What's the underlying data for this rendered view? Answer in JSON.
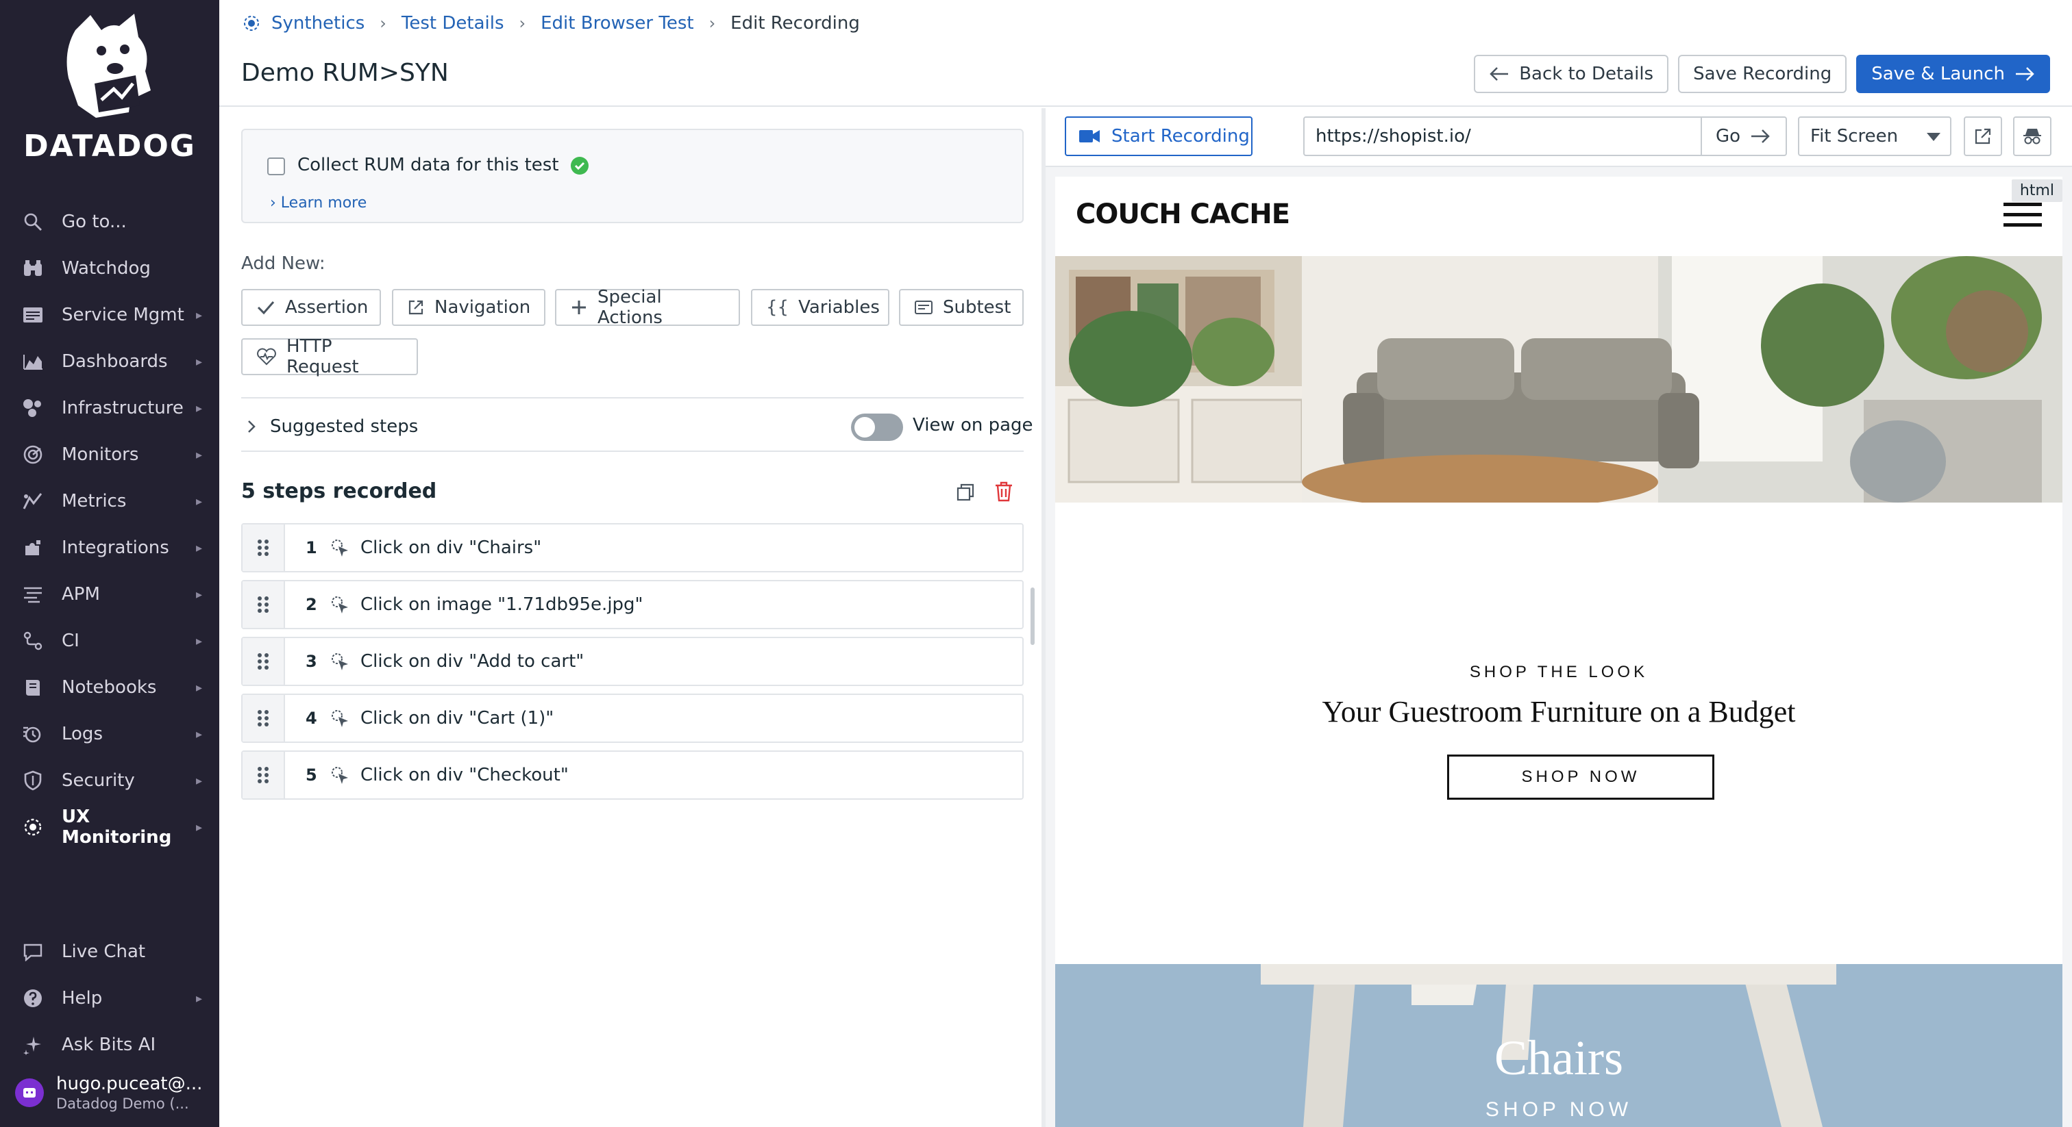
{
  "brand": {
    "name": "DATADOG",
    "colors": {
      "sidebar": "#232131",
      "link": "#2363b5",
      "primary": "#2165c8",
      "danger": "#e0373a",
      "success": "#3fb950"
    }
  },
  "sidebar": {
    "items": [
      {
        "label": "Go to...",
        "icon": "search-icon",
        "has_submenu": false
      },
      {
        "label": "Watchdog",
        "icon": "binoculars-icon",
        "has_submenu": false
      },
      {
        "label": "Service Mgmt",
        "icon": "service-icon",
        "has_submenu": true
      },
      {
        "label": "Dashboards",
        "icon": "chart-area-icon",
        "has_submenu": true
      },
      {
        "label": "Infrastructure",
        "icon": "hexagons-icon",
        "has_submenu": true
      },
      {
        "label": "Monitors",
        "icon": "monitor-icon",
        "has_submenu": true
      },
      {
        "label": "Metrics",
        "icon": "metrics-icon",
        "has_submenu": true
      },
      {
        "label": "Integrations",
        "icon": "puzzle-icon",
        "has_submenu": true
      },
      {
        "label": "APM",
        "icon": "apm-icon",
        "has_submenu": true
      },
      {
        "label": "CI",
        "icon": "ci-icon",
        "has_submenu": true
      },
      {
        "label": "Notebooks",
        "icon": "notebook-icon",
        "has_submenu": true
      },
      {
        "label": "Logs",
        "icon": "logs-icon",
        "has_submenu": true
      },
      {
        "label": "Security",
        "icon": "shield-icon",
        "has_submenu": true
      },
      {
        "label": "UX Monitoring",
        "icon": "ux-icon",
        "has_submenu": true,
        "active": true
      }
    ],
    "bottom_items": [
      {
        "label": "Live Chat",
        "icon": "chat-icon",
        "has_submenu": false
      },
      {
        "label": "Help",
        "icon": "help-icon",
        "has_submenu": true
      },
      {
        "label": "Ask Bits AI",
        "icon": "sparkle-icon",
        "has_submenu": false
      }
    ],
    "user": {
      "name": "hugo.puceat@...",
      "org": "Datadog Demo (..."
    }
  },
  "header": {
    "breadcrumb": [
      "Synthetics",
      "Test Details",
      "Edit Browser Test",
      "Edit Recording"
    ],
    "title": "Demo RUM>SYN",
    "back_label": "Back to Details",
    "save_label": "Save Recording",
    "save_launch_label": "Save & Launch"
  },
  "editor": {
    "rum_label": "Collect RUM data for this test",
    "rum_checked": false,
    "learn_more": "Learn more",
    "add_new_label": "Add New:",
    "add_buttons": {
      "assertion": "Assertion",
      "navigation": "Navigation",
      "special": "Special Actions",
      "variables": "Variables",
      "subtest": "Subtest",
      "http": "HTTP Request"
    },
    "suggested_label": "Suggested steps",
    "view_on_page_label": "View on page",
    "view_on_page_on": false,
    "steps_title": "5 steps recorded",
    "steps": [
      {
        "num": "1",
        "label": "Click on div \"Chairs\""
      },
      {
        "num": "2",
        "label": "Click on image \"1.71db95e.jpg\""
      },
      {
        "num": "3",
        "label": "Click on div \"Add to cart\""
      },
      {
        "num": "4",
        "label": "Click on div \"Cart (1)\""
      },
      {
        "num": "5",
        "label": "Click on div \"Checkout\""
      }
    ]
  },
  "preview": {
    "start_recording": "Start Recording",
    "url": "https://shopist.io/",
    "go_label": "Go",
    "fit_option": "Fit Screen",
    "html_tag": "html",
    "site": {
      "logo": "COUCH CACHE",
      "shop_look": "SHOP THE LOOK",
      "look_title": "Your Guestroom Furniture on a Budget",
      "shop_now": "SHOP NOW",
      "banner_title": "Chairs",
      "banner_cta": "SHOP NOW"
    }
  }
}
